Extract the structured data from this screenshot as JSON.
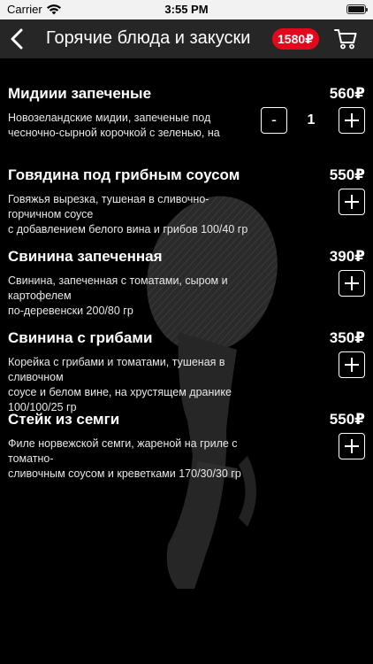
{
  "status_bar": {
    "carrier": "Carrier",
    "time": "3:55 PM"
  },
  "header": {
    "title": "Горячие блюда и закуски",
    "cart_total": "1580₽"
  },
  "menu_items": [
    {
      "name": "Мидиии запеченые",
      "price": "560₽",
      "description": "Новозеландские мидии, запеченые под\nчесночно-сырной корочкой с зеленью, на",
      "quantity": "1",
      "minus_label": "-"
    },
    {
      "name": "Говядина под грибным соусом",
      "price": "550₽",
      "description": "Говяжья вырезка, тушеная в сливочно-горчичном соусе\nс добавлением белого вина и грибов 100/40 гр"
    },
    {
      "name": "Свинина запеченная",
      "price": "390₽",
      "description": "Свинина, запеченная с томатами, сыром и картофелем\nпо-деревенски 200/80 гр"
    },
    {
      "name": "Свинина с грибами",
      "price": "350₽",
      "description": "Корейка с грибами и томатами, тушеная в сливочном\nсоусе и белом вине, на хрустящем дранике 100/100/25 гр"
    },
    {
      "name": "Стейк из семги",
      "price": "550₽",
      "description": "Филе норвежской семги, жареной на гриле с томатно-\nсливочным соусом и креветками 170/30/30 гр"
    }
  ],
  "colors": {
    "background": "#000000",
    "header": "#262626",
    "accent": "#e3081b"
  },
  "icons": {
    "back": "chevron-left-icon",
    "cart": "shopping-cart-icon",
    "add": "plus-icon",
    "wifi": "wifi-icon",
    "battery": "battery-icon"
  }
}
